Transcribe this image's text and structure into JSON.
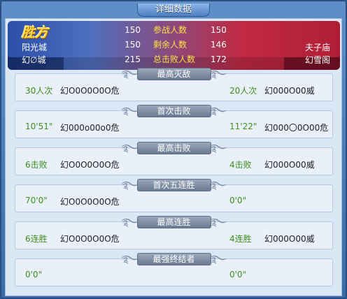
{
  "window": {
    "title": "详细数据"
  },
  "header": {
    "winner_label": "胜方",
    "left_server": "阳光城",
    "left_guild": "幻∅城",
    "right_server": "夫子庙",
    "right_guild": "幻雪阁",
    "stats": [
      {
        "left": "150",
        "label": "参战人数",
        "right": "150"
      },
      {
        "left": "150",
        "label": "剩余人数",
        "right": "146"
      },
      {
        "left": "215",
        "label": "总击败人数",
        "right": "172"
      }
    ]
  },
  "sections": [
    {
      "title": "最高灭敌",
      "left_value": "30人次",
      "left_name": "幻O0O0O0O危",
      "right_value": "20人次",
      "right_name": "幻000O00威"
    },
    {
      "title": "首次击败",
      "left_value": "10'51\"",
      "left_name": "幻000o00o0危",
      "right_value": "11'22\"",
      "right_name": "幻000〇0O00危"
    },
    {
      "title": "最高击败",
      "left_value": "6击败",
      "left_name": "幻O0O0O0O危",
      "right_value": "4击败",
      "right_name": "幻000O00威"
    },
    {
      "title": "首次五连胜",
      "left_value": "70'0\"",
      "left_name": "幻O0O0O0O危",
      "right_value": "0'0\"",
      "right_name": ""
    },
    {
      "title": "最高连胜",
      "left_value": "6连胜",
      "left_name": "幻O0O0O0O危",
      "right_value": "4连胜",
      "right_name": "幻000O00威"
    },
    {
      "title": "最强终结者",
      "left_value": "0'0\"",
      "left_name": "",
      "right_value": "0'0\"",
      "right_name": ""
    }
  ]
}
